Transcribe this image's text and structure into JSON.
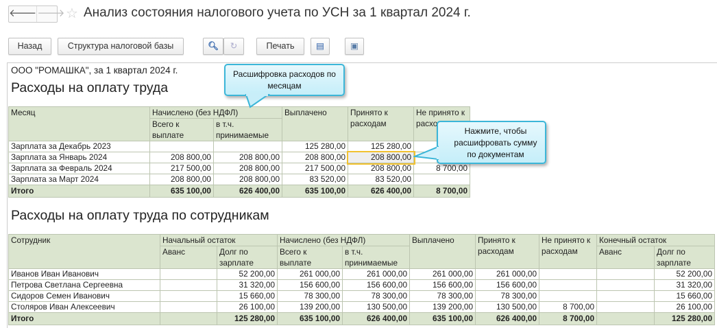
{
  "window": {
    "title": "Анализ состояния налогового учета по УСН за 1 квартал 2024 г.",
    "back_icon": "arrow-left",
    "forward_icon": "arrow-right",
    "star_icon": "star"
  },
  "toolbar": {
    "back": "Назад",
    "structure": "Структура налоговой базы",
    "print": "Печать"
  },
  "report": {
    "org": "ООО \"РОМАШКА\",  за 1 квартал 2024 г.",
    "section1": "Расходы на оплату труда",
    "section2": "Расходы на оплату труда по сотрудникам",
    "callout1": "Расшифровка расходов по месяцам",
    "callout2": "Нажмите, чтобы расшифровать сумму по документам",
    "t1": {
      "h": {
        "month": "Месяц",
        "accrued": "Начислено (без НДФЛ)",
        "total_pay": "Всего к выплате",
        "incl_accepted": "в т.ч. принимаемые",
        "paid": "Выплачено",
        "accepted": "Принято к расходам",
        "not_accepted": "Не принято к расходам"
      },
      "rows": [
        [
          "Зарплата за Декабрь 2023",
          "",
          "",
          "125 280,00",
          "125 280,00",
          ""
        ],
        [
          "Зарплата за Январь 2024",
          "208 800,00",
          "208 800,00",
          "208 800,00",
          "208 800,00",
          ""
        ],
        [
          "Зарплата за Февраль 2024",
          "217 500,00",
          "208 800,00",
          "217 500,00",
          "208 800,00",
          "8 700,00"
        ],
        [
          "Зарплата за Март 2024",
          "208 800,00",
          "208 800,00",
          "83 520,00",
          "83 520,00",
          ""
        ]
      ],
      "total": [
        "Итого",
        "635 100,00",
        "626 400,00",
        "635 100,00",
        "626 400,00",
        "8 700,00"
      ]
    },
    "t2": {
      "h": {
        "employee": "Сотрудник",
        "opening": "Начальный остаток",
        "advance": "Аванс",
        "debt": "Долг по зарплате",
        "accrued": "Начислено (без НДФЛ)",
        "total_pay": "Всего к выплате",
        "incl_accepted": "в т.ч. принимаемые",
        "paid": "Выплачено",
        "accepted": "Принято к расходам",
        "not_accepted": "Не принято к расходам",
        "closing": "Конечный остаток"
      },
      "rows": [
        [
          "Иванов Иван Иванович",
          "",
          "52 200,00",
          "261 000,00",
          "261 000,00",
          "261 000,00",
          "261 000,00",
          "",
          "",
          "52 200,00"
        ],
        [
          "Петрова Светлана Сергеевна",
          "",
          "31 320,00",
          "156 600,00",
          "156 600,00",
          "156 600,00",
          "156 600,00",
          "",
          "",
          "31 320,00"
        ],
        [
          "Сидоров Семен Иванович",
          "",
          "15 660,00",
          "78 300,00",
          "78 300,00",
          "78 300,00",
          "78 300,00",
          "",
          "",
          "15 660,00"
        ],
        [
          "Столяров Иван Алексеевич",
          "",
          "26 100,00",
          "139 200,00",
          "130 500,00",
          "139 200,00",
          "130 500,00",
          "8 700,00",
          "",
          "26 100,00"
        ]
      ],
      "total": [
        "Итого",
        "",
        "125 280,00",
        "635 100,00",
        "626 400,00",
        "635 100,00",
        "626 400,00",
        "8 700,00",
        "",
        "125 280,00"
      ]
    }
  }
}
